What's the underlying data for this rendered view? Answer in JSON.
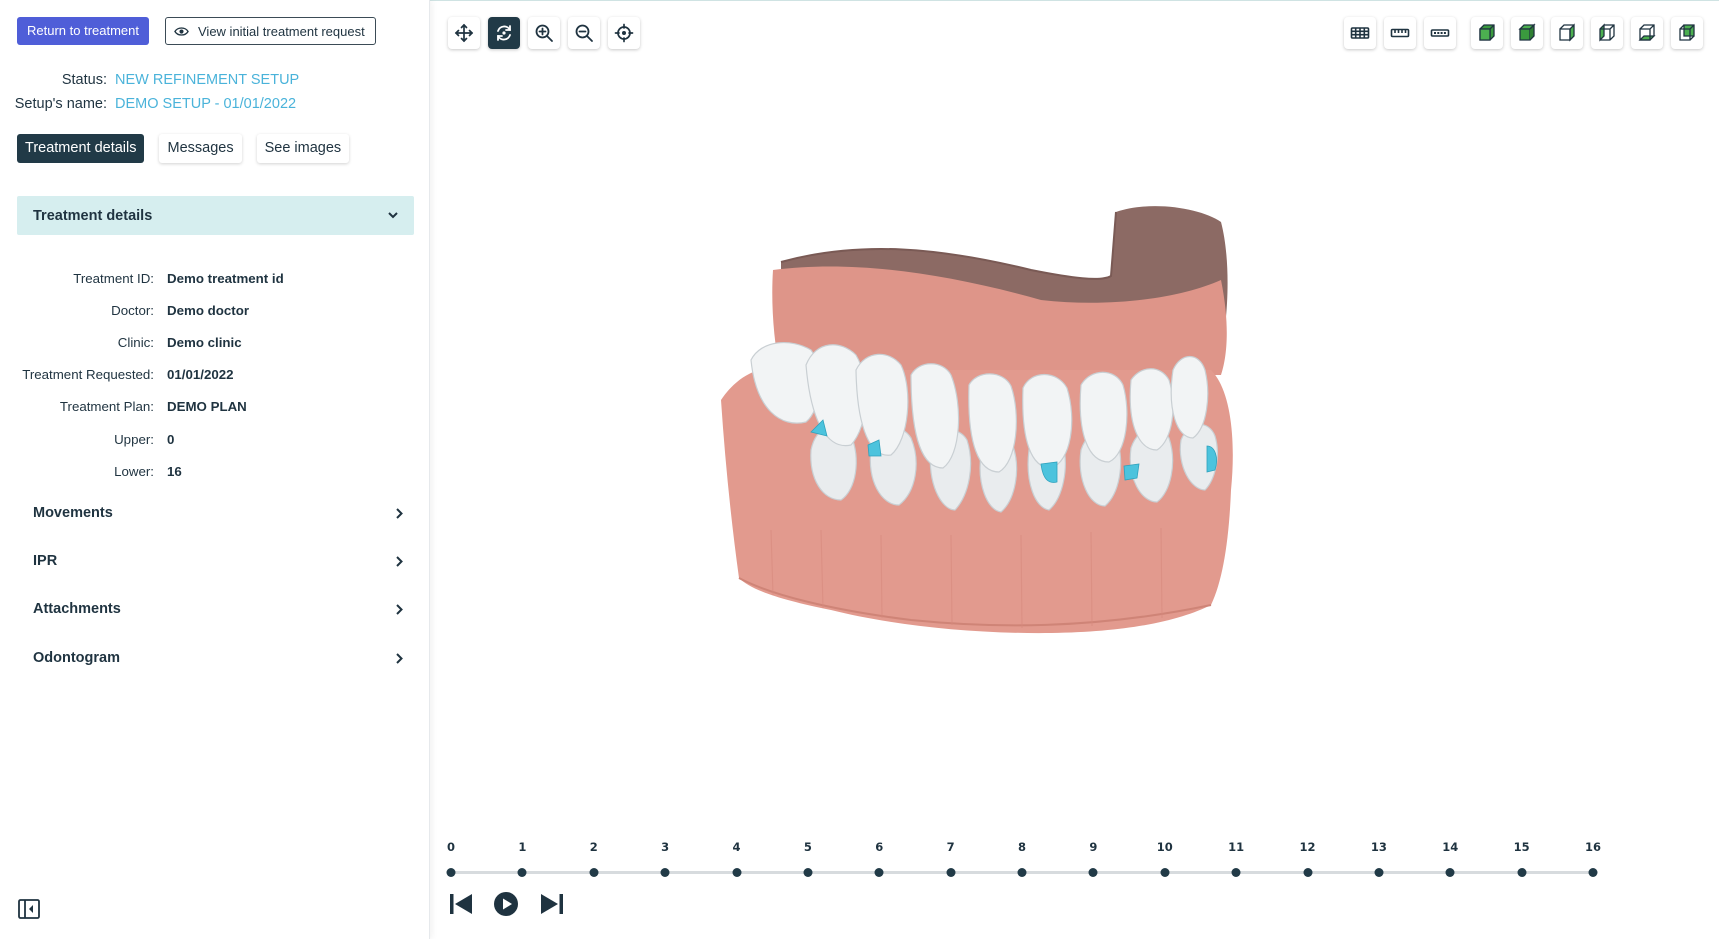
{
  "header": {
    "return_button": "Return to treatment",
    "view_request_button": "View initial treatment request"
  },
  "status": {
    "status_label": "Status:",
    "status_value": "NEW REFINEMENT SETUP",
    "setup_label": "Setup's name:",
    "setup_value": "DEMO SETUP - 01/01/2022"
  },
  "tabs": [
    {
      "label": "Treatment details",
      "active": true
    },
    {
      "label": "Messages",
      "active": false
    },
    {
      "label": "See images",
      "active": false
    }
  ],
  "treatment_details": {
    "title": "Treatment details",
    "rows": [
      {
        "label": "Treatment ID:",
        "value": "Demo treatment id"
      },
      {
        "label": "Doctor:",
        "value": "Demo doctor"
      },
      {
        "label": "Clinic:",
        "value": "Demo clinic"
      },
      {
        "label": "Treatment Requested:",
        "value": "01/01/2022"
      },
      {
        "label": "Treatment Plan:",
        "value": "DEMO PLAN"
      },
      {
        "label": "Upper:",
        "value": "0"
      },
      {
        "label": "Lower:",
        "value": "16"
      }
    ]
  },
  "sections": [
    {
      "label": "Movements"
    },
    {
      "label": "IPR"
    },
    {
      "label": "Attachments"
    },
    {
      "label": "Odontogram"
    }
  ],
  "toolbar_left": [
    {
      "icon": "move-icon",
      "active": false
    },
    {
      "icon": "rotate-icon",
      "active": true
    },
    {
      "icon": "zoom-in-icon",
      "active": false
    },
    {
      "icon": "zoom-out-icon",
      "active": false
    },
    {
      "icon": "center-target-icon",
      "active": false
    }
  ],
  "toolbar_right": [
    {
      "icon": "grid-icon"
    },
    {
      "icon": "ruler-icon"
    },
    {
      "icon": "dotted-ruler-icon"
    },
    {
      "icon": "cube-front-view-icon"
    },
    {
      "icon": "cube-top-view-icon"
    },
    {
      "icon": "cube-right-view-icon"
    },
    {
      "icon": "cube-left-view-icon"
    },
    {
      "icon": "cube-bottom-view-icon"
    },
    {
      "icon": "cube-back-view-icon"
    }
  ],
  "timeline": {
    "steps": [
      "0",
      "1",
      "2",
      "3",
      "4",
      "5",
      "6",
      "7",
      "8",
      "9",
      "10",
      "11",
      "12",
      "13",
      "14",
      "15",
      "16"
    ],
    "current_step": 0
  },
  "playback": {
    "controls": [
      "skip-to-start-icon",
      "play-icon",
      "skip-to-end-icon"
    ]
  },
  "colors": {
    "primary": "#4f5ed8",
    "dark": "#213a47",
    "accent_text": "#4ab3da",
    "accordion_bg": "#d6eeef",
    "gum": "#e0968a",
    "tooth": "#f4f6f7",
    "attachment": "#4cc3dd",
    "cube_green": "#3a9a3e"
  }
}
